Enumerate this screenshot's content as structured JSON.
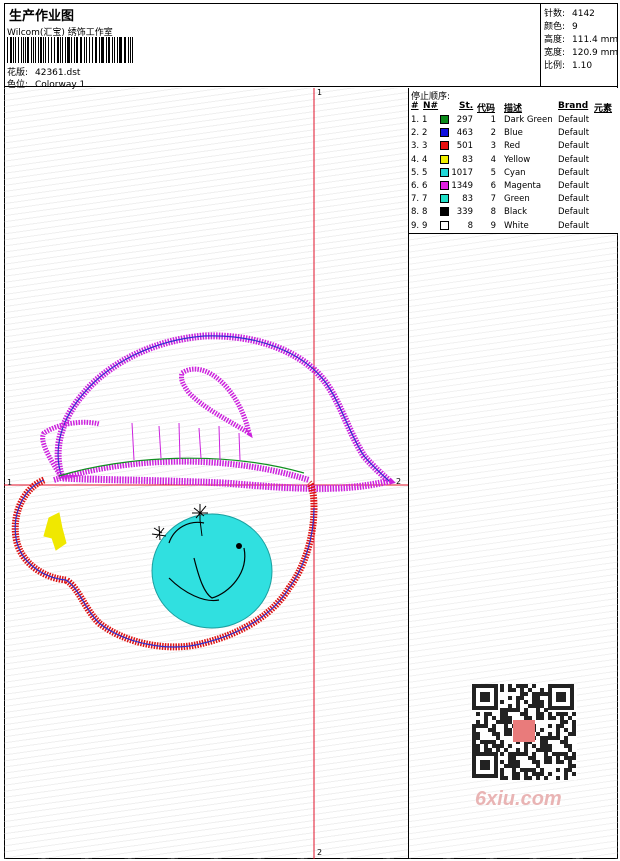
{
  "header": {
    "title": "生产作业图",
    "subtitle": "Wilcom(汇宝) 绣饰工作室",
    "design_label": "花版:",
    "design_value": "42361.dst",
    "colorway_label": "色位:",
    "colorway_value": "Colorway 1"
  },
  "stats": [
    {
      "label": "针数:",
      "value": "4142"
    },
    {
      "label": "颜色:",
      "value": "9"
    },
    {
      "label": "高度:",
      "value": "111.4 mm"
    },
    {
      "label": "宽度:",
      "value": "120.9 mm"
    },
    {
      "label": "比例:",
      "value": "1.10"
    }
  ],
  "stop_table": {
    "title": "停止顺序:",
    "headers": {
      "num": "#",
      "no": "N#",
      "stitches": "St.",
      "code": "代码",
      "desc": "描述",
      "brand": "Brand",
      "element": "元素"
    },
    "rows": [
      {
        "num": "1.",
        "no": "1",
        "color": "#0a8a1a",
        "stitches": "297",
        "code": "1",
        "desc": "Dark Green",
        "brand": "Default"
      },
      {
        "num": "2.",
        "no": "2",
        "color": "#1010e0",
        "stitches": "463",
        "code": "2",
        "desc": "Blue",
        "brand": "Default"
      },
      {
        "num": "3.",
        "no": "3",
        "color": "#e81010",
        "stitches": "501",
        "code": "3",
        "desc": "Red",
        "brand": "Default"
      },
      {
        "num": "4.",
        "no": "4",
        "color": "#f0f000",
        "stitches": "83",
        "code": "4",
        "desc": "Yellow",
        "brand": "Default"
      },
      {
        "num": "5.",
        "no": "5",
        "color": "#20d8d8",
        "stitches": "1017",
        "code": "5",
        "desc": "Cyan",
        "brand": "Default"
      },
      {
        "num": "6.",
        "no": "6",
        "color": "#e020e0",
        "stitches": "1349",
        "code": "6",
        "desc": "Magenta",
        "brand": "Default"
      },
      {
        "num": "7.",
        "no": "7",
        "color": "#20e0c8",
        "stitches": "83",
        "code": "7",
        "desc": "Green",
        "brand": "Default"
      },
      {
        "num": "8.",
        "no": "8",
        "color": "#000000",
        "stitches": "339",
        "code": "8",
        "desc": "Black",
        "brand": "Default"
      },
      {
        "num": "9.",
        "no": "9",
        "color": "#ffffff",
        "stitches": "8",
        "code": "9",
        "desc": "White",
        "brand": "Default"
      }
    ]
  },
  "axes": {
    "top": "1",
    "left": "1",
    "right": "2",
    "bottom": "2"
  },
  "watermark": {
    "text": "6xiu.com"
  },
  "colors": {
    "guide_line": "#e0102a",
    "magenta": "#cc22dd",
    "blue": "#3030d0",
    "red": "#dd1111",
    "cyan": "#30e0e0",
    "dark_green": "#109020",
    "yellow": "#f0e800",
    "black": "#000000"
  }
}
